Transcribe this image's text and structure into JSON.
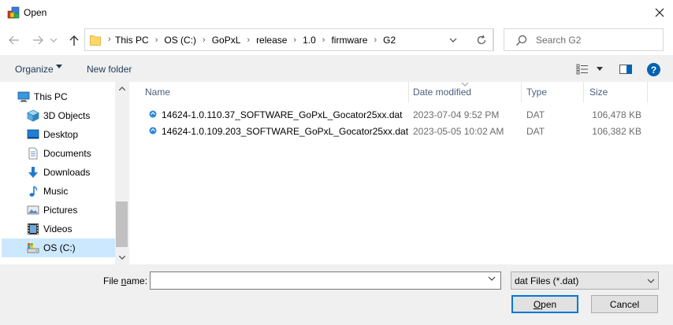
{
  "window": {
    "title": "Open",
    "icon": "open-file-app-icon",
    "close_icon": "close-icon"
  },
  "address": {
    "icons": {
      "back": "arrow-left-icon",
      "forward": "arrow-right-icon",
      "recent": "chevron-down-icon",
      "up": "arrow-up-icon",
      "folder": "folder-icon",
      "refresh": "refresh-icon"
    },
    "breadcrumbs": [
      "This PC",
      "OS (C:)",
      "GoPxL",
      "release",
      "1.0",
      "firmware",
      "G2"
    ],
    "search_placeholder": "Search G2"
  },
  "toolbar": {
    "organize_label": "Organize",
    "new_folder_label": "New folder",
    "help_label": "?"
  },
  "nav": {
    "items": [
      {
        "label": "This PC",
        "icon": "computer-icon",
        "indent": 0
      },
      {
        "label": "3D Objects",
        "icon": "cube-icon",
        "indent": 1
      },
      {
        "label": "Desktop",
        "icon": "desktop-icon",
        "indent": 1
      },
      {
        "label": "Documents",
        "icon": "document-icon",
        "indent": 1
      },
      {
        "label": "Downloads",
        "icon": "download-icon",
        "indent": 1
      },
      {
        "label": "Music",
        "icon": "music-icon",
        "indent": 1
      },
      {
        "label": "Pictures",
        "icon": "pictures-icon",
        "indent": 1
      },
      {
        "label": "Videos",
        "icon": "video-icon",
        "indent": 1
      },
      {
        "label": "OS (C:)",
        "icon": "drive-icon",
        "indent": 1,
        "selected": true
      }
    ]
  },
  "files": {
    "columns": {
      "name": "Name",
      "date": "Date modified",
      "type": "Type",
      "size": "Size"
    },
    "rows": [
      {
        "name": "14624-1.0.110.37_SOFTWARE_GoPxL_Gocator25xx.dat",
        "date": "2023-07-04 9:52 PM",
        "type": "DAT",
        "size": "106,478 KB"
      },
      {
        "name": "14624-1.0.109.203_SOFTWARE_GoPxL_Gocator25xx.dat",
        "date": "2023-05-05 10:02 AM",
        "type": "DAT",
        "size": "106,382 KB"
      }
    ]
  },
  "footer": {
    "file_name_label_pre": "File ",
    "file_name_label_acc": "n",
    "file_name_label_post": "ame:",
    "file_name_value": "",
    "file_type_value": "dat Files (*.dat)",
    "open_label_acc": "O",
    "open_label_rest": "pen",
    "cancel_label": "Cancel"
  },
  "colors": {
    "accent": "#0078d7",
    "selection": "#cce8ff",
    "link_text": "#1e3957",
    "header_text": "#4c607a"
  }
}
